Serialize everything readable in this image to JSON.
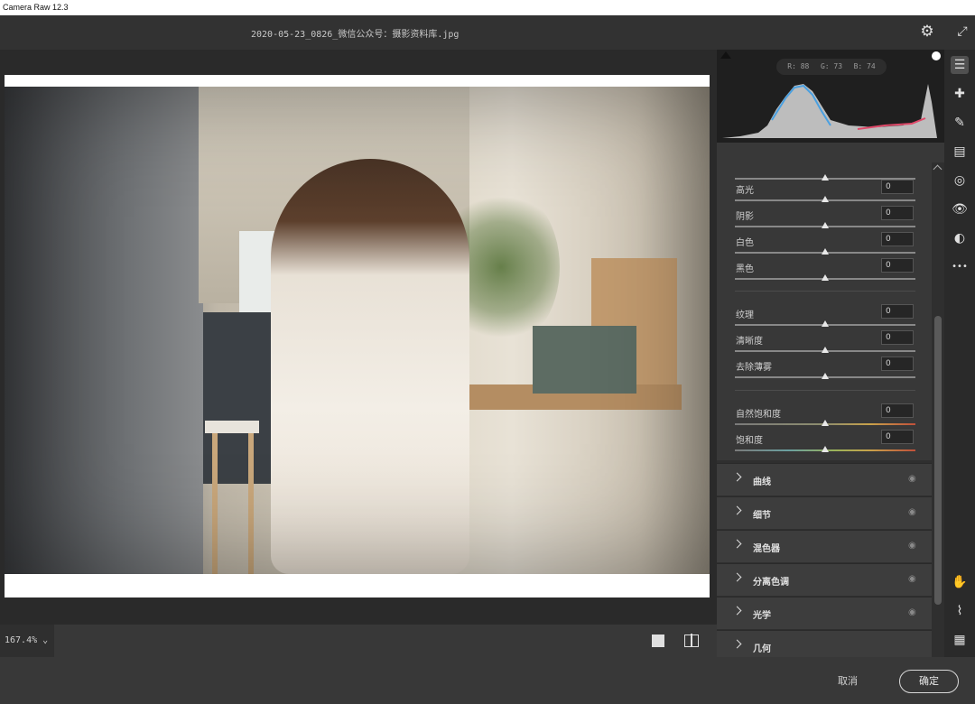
{
  "app": {
    "title": "Camera Raw 12.3"
  },
  "header": {
    "filename": "2020-05-23_0826_微信公众号：摄影资料库.jpg",
    "settings_icon": "gear-icon",
    "fullscreen_icon": "expand-icon"
  },
  "histogram": {
    "r": "R: 88",
    "g": "G: 73",
    "b": "B: 74"
  },
  "sliders": [
    {
      "label": "",
      "value": "",
      "fill": 0.5
    },
    {
      "label": "高光",
      "value": "0",
      "fill": 0.5
    },
    {
      "label": "阴影",
      "value": "0",
      "fill": 0.5
    },
    {
      "label": "白色",
      "value": "0",
      "fill": 0.5
    },
    {
      "label": "黑色",
      "value": "0",
      "fill": 0.5
    },
    {
      "label": "纹理",
      "value": "0",
      "fill": 0.5
    },
    {
      "label": "清晰度",
      "value": "0",
      "fill": 0.5
    },
    {
      "label": "去除薄雾",
      "value": "0",
      "fill": 0.5
    },
    {
      "label": "自然饱和度",
      "value": "0",
      "fill": 0.5
    },
    {
      "label": "饱和度",
      "value": "0",
      "fill": 0.5
    }
  ],
  "sections": [
    {
      "label": "曲线"
    },
    {
      "label": "细节"
    },
    {
      "label": "混色器"
    },
    {
      "label": "分离色调"
    },
    {
      "label": "光学"
    },
    {
      "label": "几何"
    }
  ],
  "zoom": {
    "value": "167.4%"
  },
  "tools": [
    "edit-icon",
    "heal-icon",
    "brush-icon",
    "gradient-icon",
    "radial-icon",
    "redeye-icon",
    "presets-icon",
    "more-icon"
  ],
  "tools_bottom": [
    "hand-icon",
    "eyedropper-icon",
    "grid-icon"
  ],
  "footer": {
    "cancel": "取消",
    "ok": "确定"
  }
}
